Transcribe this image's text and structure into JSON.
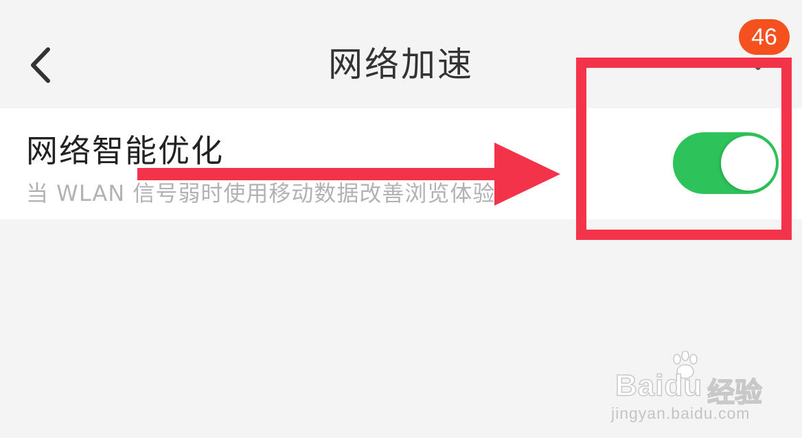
{
  "header": {
    "title": "网络加速",
    "badge_count": "46"
  },
  "setting": {
    "title": "网络智能优化",
    "description": "当 WLAN 信号弱时使用移动数据改善浏览体验。",
    "toggle_on": true,
    "toggle_color": "#2ec25a"
  },
  "annotation": {
    "box_color": "#f2334a",
    "arrow_color": "#f2334a"
  },
  "watermark": {
    "brand": "Baidu",
    "product": "经验",
    "url": "jingyan.baidu.com"
  },
  "icons": {
    "back": "chevron-left-icon",
    "more": "more-dot-icon",
    "paw": "baidu-paw-icon"
  }
}
